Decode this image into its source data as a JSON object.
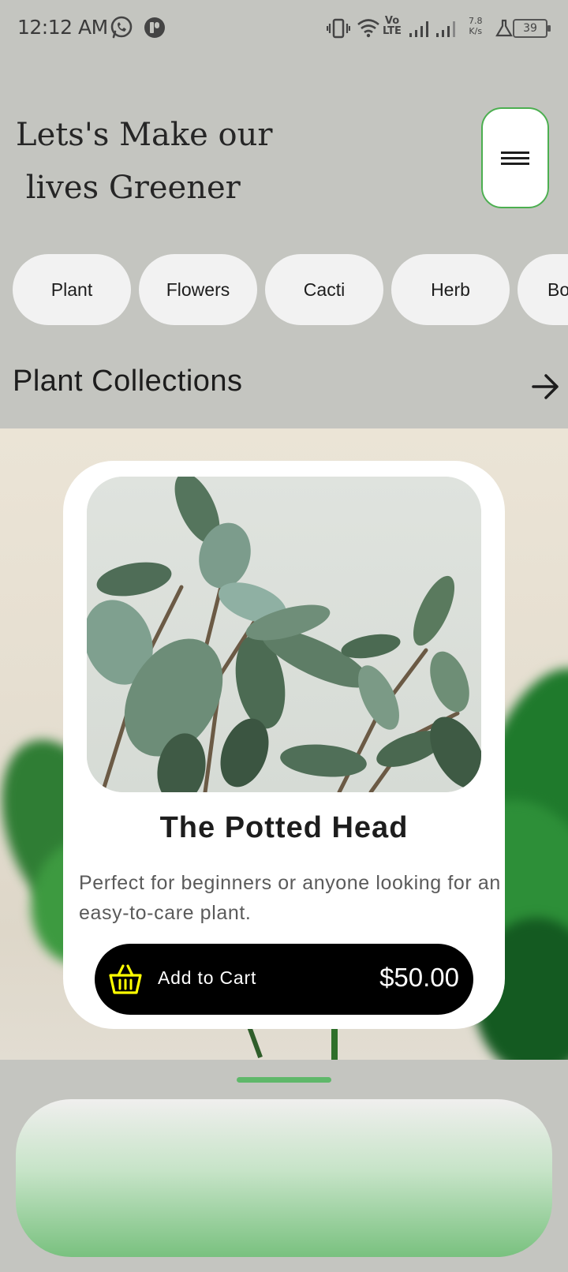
{
  "status_bar": {
    "time": "12:12 AM",
    "network": "Vo LTE",
    "speed_value": "7.8",
    "speed_unit": "K/s",
    "battery": "39",
    "icons": [
      "whatsapp-icon",
      "notification-icon",
      "vibrate-icon",
      "wifi-icon",
      "signal-icon",
      "signal-icon",
      "lab-icon",
      "battery-icon"
    ]
  },
  "header": {
    "headline": "Lets's Make our\n lives Greener",
    "menu_icon": "hamburger-icon"
  },
  "categories": [
    "Plant",
    "Flowers",
    "Cacti",
    "Herb",
    "Bo"
  ],
  "section": {
    "title": "Plant Collections",
    "arrow_icon": "arrow-right-icon"
  },
  "product": {
    "title": "The Potted Head",
    "description": "Perfect for beginners or anyone looking for an easy-to-care plant.",
    "cart_label": "Add to Cart",
    "price": "$50.00",
    "cart_icon": "basket-icon"
  },
  "colors": {
    "background": "#c4c5c0",
    "accent_green": "#4caf50",
    "cart_button": "#000000",
    "basket_yellow": "#ffff00"
  }
}
